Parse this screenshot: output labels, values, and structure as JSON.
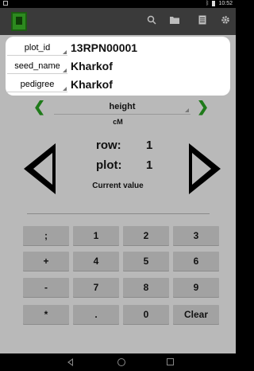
{
  "status_bar": {
    "bluetooth": "ᛒ",
    "time": "10:52"
  },
  "action_bar": {
    "icons": [
      "search-icon",
      "folder-icon",
      "list-icon",
      "settings-icon"
    ]
  },
  "info": {
    "rows": [
      {
        "label": "plot_id",
        "value": "13RPN00001"
      },
      {
        "label": "seed_name",
        "value": "Kharkof"
      },
      {
        "label": "pedigree",
        "value": "Kharkof"
      }
    ]
  },
  "trait": {
    "name": "height",
    "unit": "cM"
  },
  "position": {
    "row_label": "row:",
    "row_value": "1",
    "plot_label": "plot:",
    "plot_value": "1"
  },
  "current_value_label": "Current value",
  "entry": {
    "value": ""
  },
  "keypad": {
    "keys": [
      [
        ";",
        "1",
        "2",
        "3"
      ],
      [
        "+",
        "4",
        "5",
        "6"
      ],
      [
        "-",
        "7",
        "8",
        "9"
      ],
      [
        "*",
        ".",
        "0",
        "Clear"
      ]
    ]
  },
  "colors": {
    "accent": "#1f7a1a",
    "panel": "#b9b9b9",
    "key": "#a2a2a2"
  }
}
